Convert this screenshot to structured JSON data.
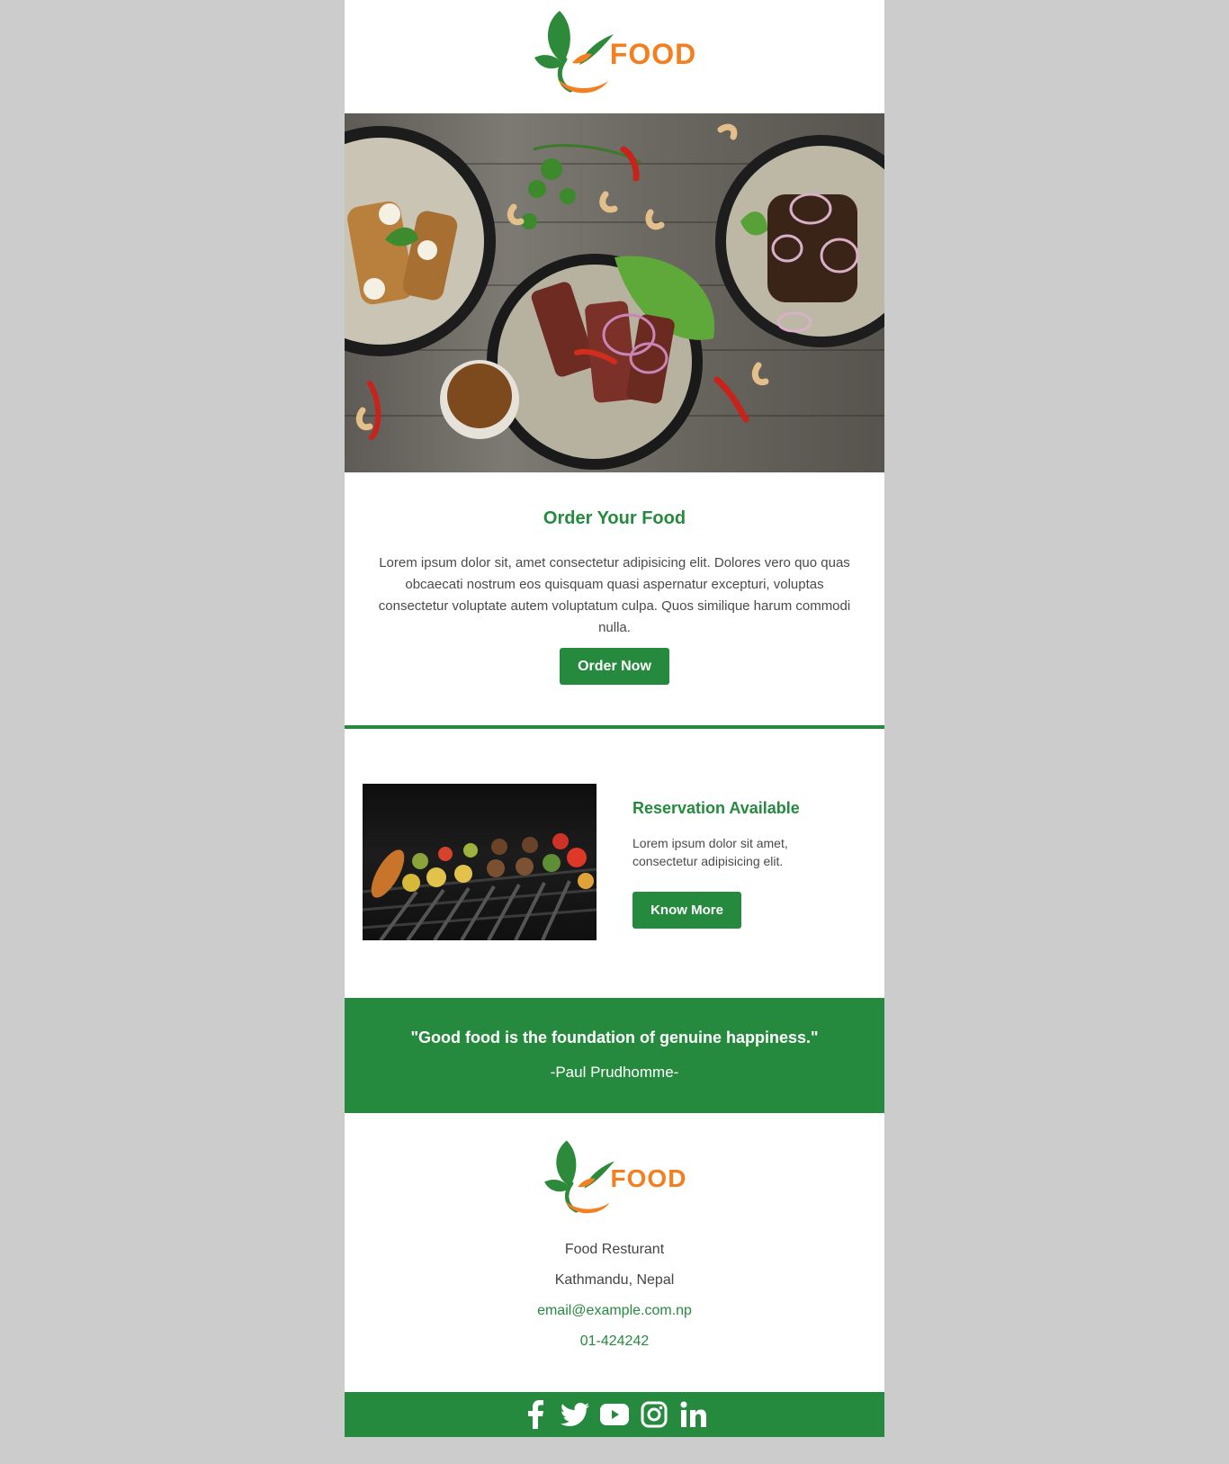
{
  "header": {
    "logo_text": "FOOD"
  },
  "order": {
    "title": "Order Your Food",
    "text": "Lorem ipsum dolor sit, amet consectetur adipisicing elit. Dolores vero quo quas obcaecati nostrum eos quisquam quasi aspernatur excepturi, voluptas consectetur voluptate autem voluptatum culpa. Quos similique harum commodi nulla.",
    "button": "Order Now"
  },
  "reservation": {
    "title": "Reservation Available",
    "text": "Lorem ipsum dolor sit amet, consectetur adipisicing elit.",
    "button": "Know More"
  },
  "quote": {
    "text": "\"Good food is the foundation of genuine happiness.\"",
    "author": "-Paul Prudhomme-"
  },
  "footer": {
    "logo_text": "FOOD",
    "name": "Food Resturant",
    "address": "Kathmandu, Nepal",
    "email": "email@example.com.np",
    "phone": "01-424242"
  },
  "social": [
    "facebook-icon",
    "twitter-icon",
    "youtube-icon",
    "instagram-icon",
    "linkedin-icon"
  ],
  "colors": {
    "accent": "#258a3e",
    "logo_orange": "#f47f20",
    "page_bg": "#cccccc"
  }
}
